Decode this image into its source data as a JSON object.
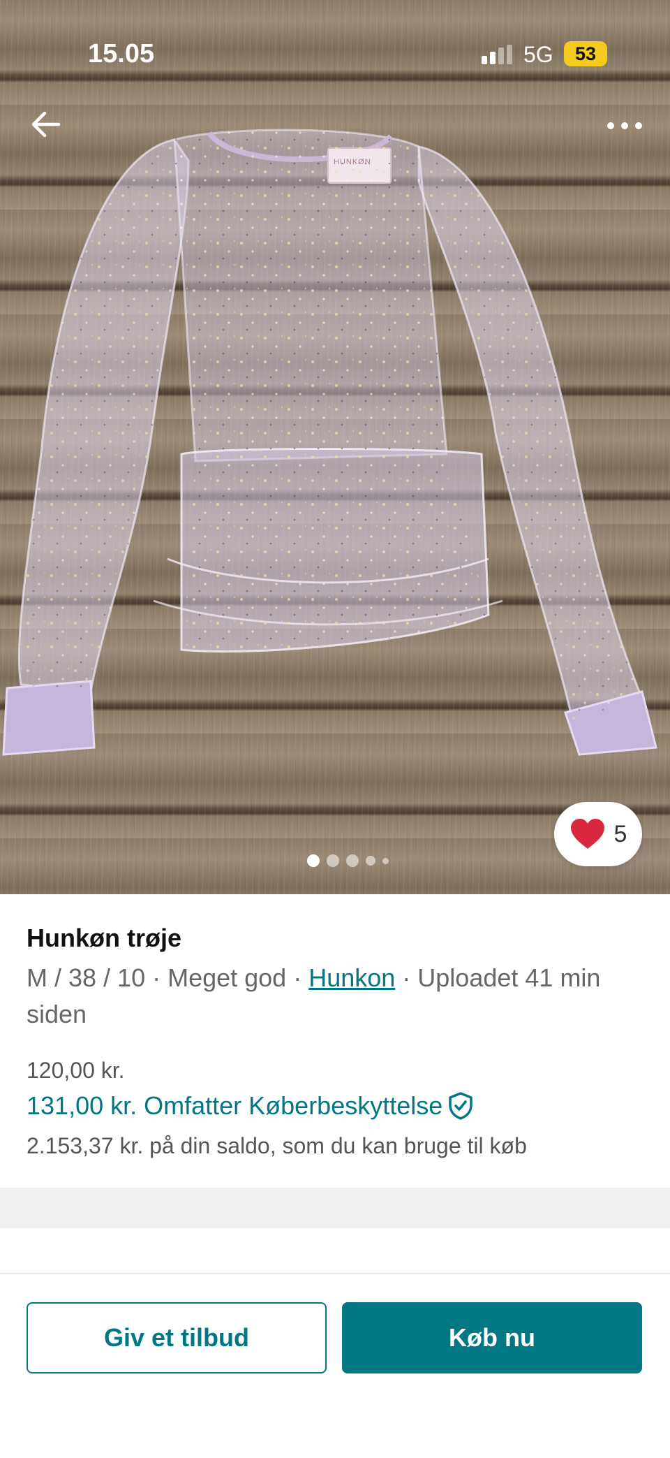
{
  "status_bar": {
    "time": "15.05",
    "network": "5G",
    "battery": "53"
  },
  "hero": {
    "label_text": "HUNKØN",
    "favorites_count": "5",
    "image_count": 5,
    "active_image_index": 0,
    "icons": {
      "back": "arrow-left-icon",
      "more": "more-horizontal-icon",
      "favorite": "heart-icon"
    }
  },
  "item": {
    "title": "Hunkøn trøje",
    "meta_prefix": "M / 38 / 10 · Meget god · ",
    "brand": "Hunkon",
    "meta_suffix": " · Uploadet 41 min siden",
    "price": "120,00 kr.",
    "price_with_protection": "131,00 kr. Omfatter Køberbeskyttelse",
    "balance_note": "2.153,37 kr. på din saldo, som du kan bruge til køb"
  },
  "actions": {
    "offer_label": "Giv et tilbud",
    "buy_label": "Køb nu"
  },
  "colors": {
    "accent": "#007782",
    "favorite": "#d9273e",
    "battery": "#f5cc1d"
  }
}
